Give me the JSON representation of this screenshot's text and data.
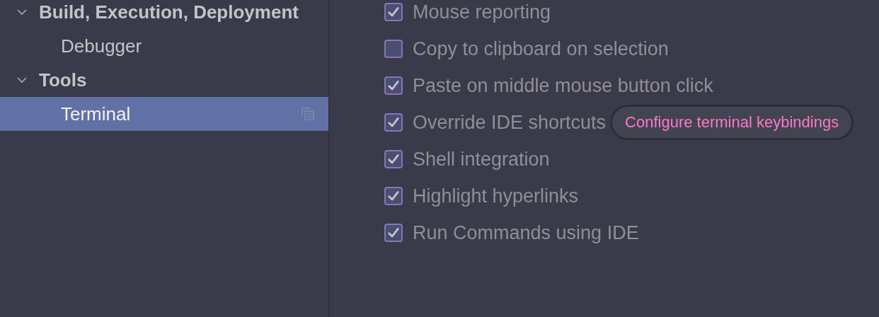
{
  "sidebar": {
    "items": [
      {
        "label": "Build, Execution, Deployment",
        "expanded": true,
        "selected": false,
        "children": [
          {
            "label": "Debugger",
            "selected": false
          }
        ]
      },
      {
        "label": "Tools",
        "expanded": true,
        "selected": false,
        "children": [
          {
            "label": "Terminal",
            "selected": true
          }
        ]
      }
    ]
  },
  "options": [
    {
      "label": "Mouse reporting",
      "checked": true
    },
    {
      "label": "Copy to clipboard on selection",
      "checked": false
    },
    {
      "label": "Paste on middle mouse button click",
      "checked": true
    },
    {
      "label": "Override IDE shortcuts",
      "checked": true,
      "link": "Configure terminal keybindings"
    },
    {
      "label": "Shell integration",
      "checked": true
    },
    {
      "label": "Highlight hyperlinks",
      "checked": true
    },
    {
      "label": "Run Commands using IDE",
      "checked": true
    }
  ]
}
